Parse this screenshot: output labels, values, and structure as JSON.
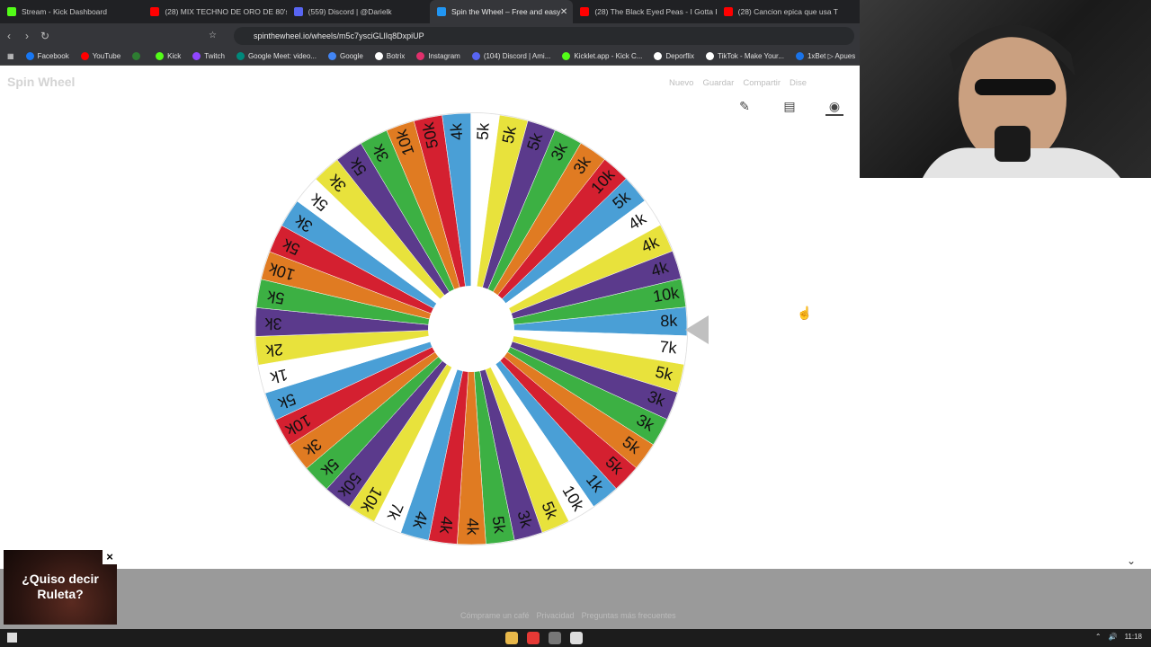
{
  "tabs": [
    {
      "label": "Stream - Kick Dashboard",
      "color": "#53fc18",
      "active": false
    },
    {
      "label": "(28) MIX TECHNO DE ORO DE 80's &",
      "color": "#ff0000",
      "active": false
    },
    {
      "label": "(559) Discord | @Darielk",
      "color": "#5865f2",
      "active": false
    },
    {
      "label": "Spin the Wheel – Free and easy",
      "color": "#2196f3",
      "active": true
    },
    {
      "label": "(28) The Black Eyed Peas - I Gotta Fe",
      "color": "#ff0000",
      "active": false
    },
    {
      "label": "(28) Cancion epica que usa T",
      "color": "#ff0000",
      "active": false
    }
  ],
  "address": {
    "url": "spinthewheel.io/wheels/m5c7ysciGLlIq8DxpiUP"
  },
  "bookmarks": [
    {
      "label": "Facebook",
      "color": "#1877f2"
    },
    {
      "label": "YouTube",
      "color": "#ff0000"
    },
    {
      "label": "",
      "color": "#2e7d32"
    },
    {
      "label": "Kick",
      "color": "#53fc18"
    },
    {
      "label": "Twitch",
      "color": "#9146ff"
    },
    {
      "label": "Google Meet: video...",
      "color": "#00897b"
    },
    {
      "label": "Google",
      "color": "#4285f4"
    },
    {
      "label": "Botrix",
      "color": "#ffffff"
    },
    {
      "label": "Instagram",
      "color": "#e1306c"
    },
    {
      "label": "(104) Discord | Ami...",
      "color": "#5865f2"
    },
    {
      "label": "Kicklet.app - Kick C...",
      "color": "#53fc18"
    },
    {
      "label": "Deporflix",
      "color": "#ffffff"
    },
    {
      "label": "TikTok - Make Your...",
      "color": "#ffffff"
    },
    {
      "label": "1xBet ▷ Apues",
      "color": "#1a73e8"
    }
  ],
  "site": {
    "logo": "Spin Wheel",
    "menu": [
      "Nuevo",
      "Guardar",
      "Compartir",
      "Dise"
    ],
    "tools": [
      {
        "icon": "pencil-icon",
        "glyph": "✎"
      },
      {
        "icon": "clipboard-icon",
        "glyph": "📋"
      },
      {
        "icon": "eye-off-icon",
        "glyph": "👁"
      }
    ]
  },
  "wheel": {
    "palette": [
      "#4a9fd6",
      "#ffffff",
      "#e8e23c",
      "#5b3a8c",
      "#3cb043",
      "#e07b22",
      "#d42030"
    ],
    "segments": [
      "8k",
      "7k",
      "5k",
      "3k",
      "3k",
      "5k",
      "5k",
      "1k",
      "10k",
      "5k",
      "3k",
      "5k",
      "4k",
      "4k",
      "4k",
      "7k",
      "10k",
      "50k",
      "5k",
      "3k",
      "10k",
      "5k",
      "1k",
      "2k",
      "3k",
      "5k",
      "10k",
      "5k",
      "3k",
      "5k",
      "3k",
      "5k",
      "3k",
      "10k",
      "50k",
      "4k",
      "5k",
      "5k",
      "5k",
      "3k",
      "3k",
      "10k",
      "5k",
      "4k",
      "4k",
      "4k",
      "10k"
    ]
  },
  "ad": {
    "text": "¿Quiso decir Ruleta?",
    "close": "×"
  },
  "footer": {
    "links": [
      "Cómprame un café",
      "Privacidad",
      "Preguntas más frecuentes"
    ]
  },
  "taskbar": {
    "time": "11:18"
  }
}
